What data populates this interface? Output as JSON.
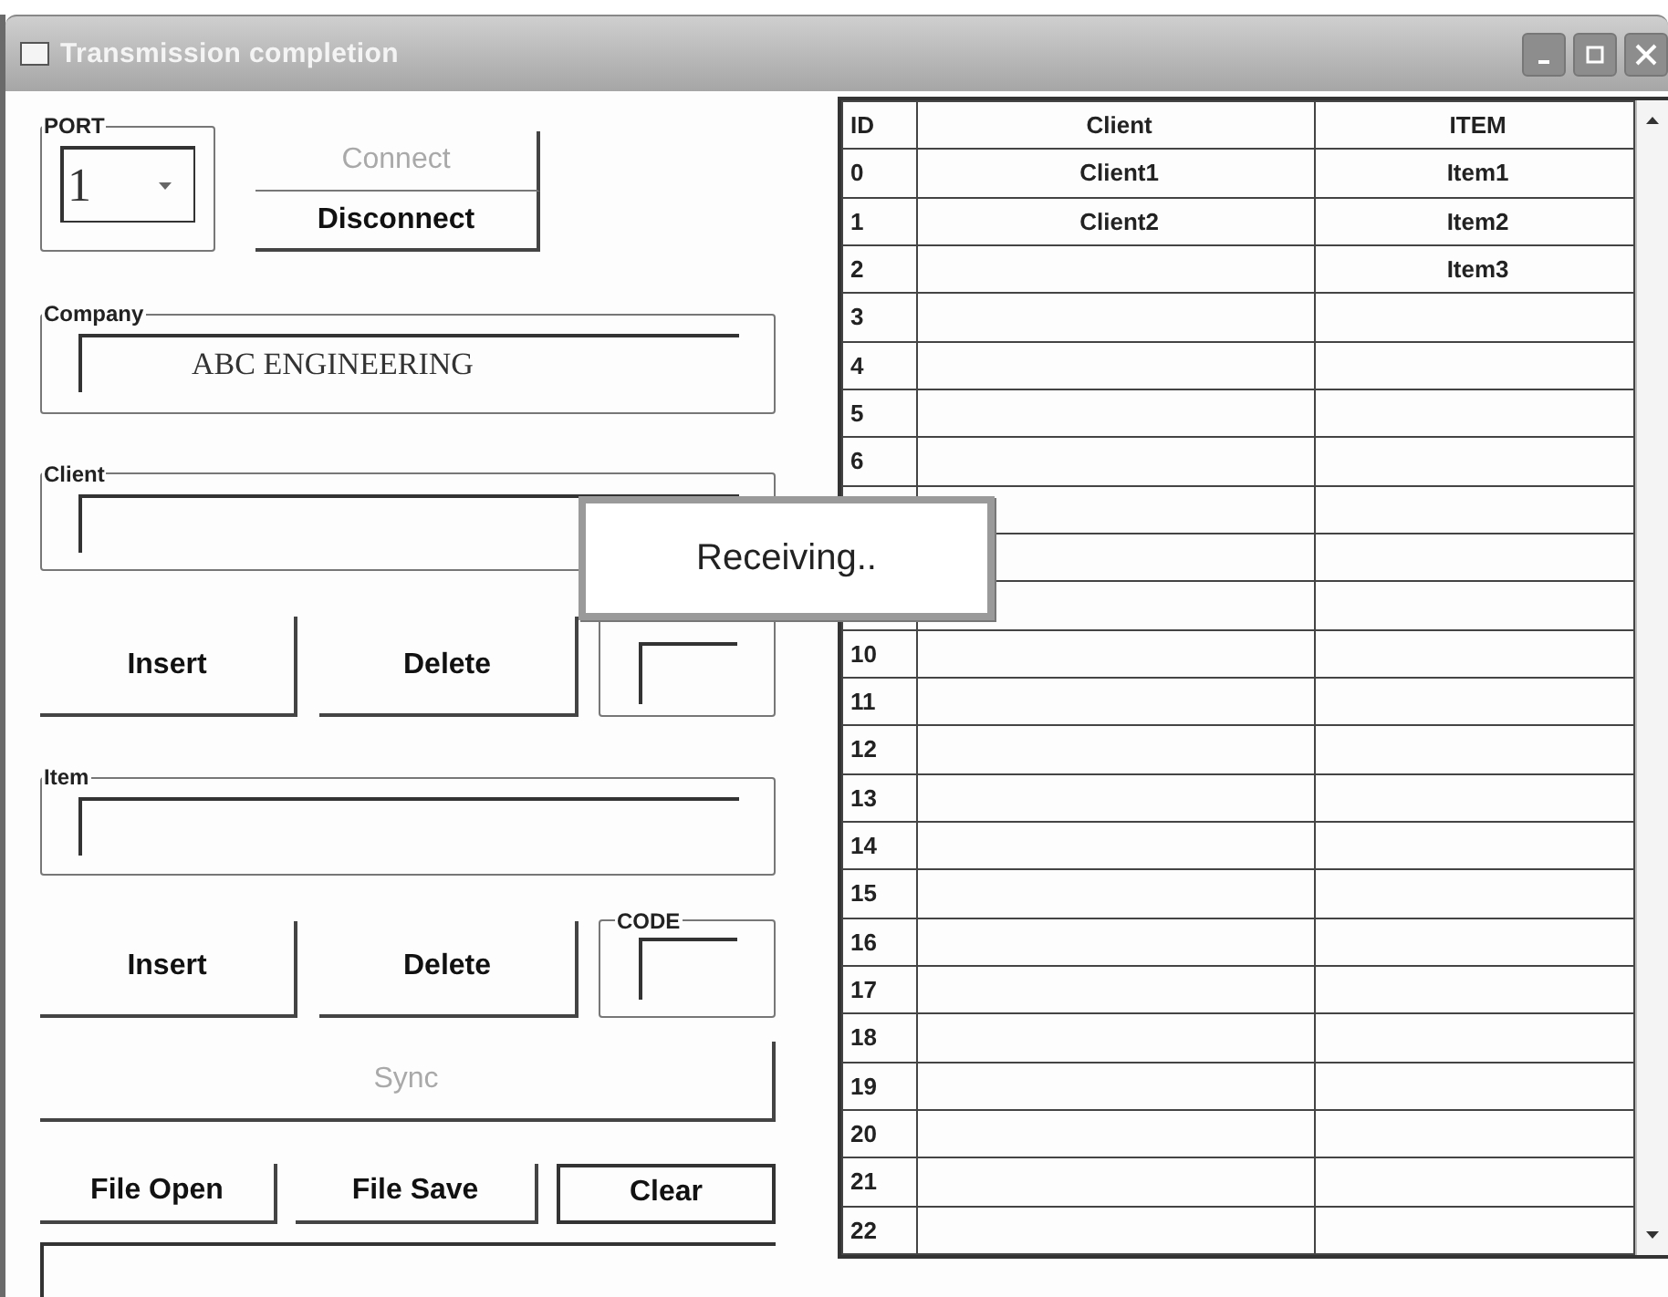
{
  "window": {
    "title": "Transmission completion"
  },
  "port": {
    "label": "PORT",
    "value": "1"
  },
  "connection_buttons": [
    {
      "label": "Connect",
      "disabled": true
    },
    {
      "label": "Disconnect",
      "disabled": false
    }
  ],
  "company": {
    "label": "Company",
    "value": "ABC ENGINEERING"
  },
  "client": {
    "label": "Client"
  },
  "client_actions": {
    "buttons": [
      {
        "label": "Insert"
      },
      {
        "label": "Delete"
      }
    ]
  },
  "item": {
    "label": "Item"
  },
  "item_actions": {
    "buttons": [
      {
        "label": "Insert"
      },
      {
        "label": "Delete"
      }
    ],
    "code_label": "CODE"
  },
  "sync_button": {
    "label": "Sync",
    "disabled": true
  },
  "file_buttons": [
    {
      "label": "File Open",
      "focused": false
    },
    {
      "label": "File Save",
      "focused": false
    },
    {
      "label": "Clear",
      "focused": true
    }
  ],
  "table": {
    "columns": [
      "ID",
      "Client",
      "ITEM"
    ],
    "rows": [
      {
        "id": "0",
        "client": "Client1",
        "item": "Item1"
      },
      {
        "id": "1",
        "client": "Client2",
        "item": "Item2"
      },
      {
        "id": "2",
        "item": "Item3"
      },
      {
        "id": "3"
      },
      {
        "id": "4"
      },
      {
        "id": "5"
      },
      {
        "id": "6"
      },
      {},
      {},
      {},
      {
        "id": "10"
      },
      {
        "id": "11"
      },
      {
        "id": "12"
      },
      {
        "id": "13"
      },
      {
        "id": "14"
      },
      {
        "id": "15"
      },
      {
        "id": "16"
      },
      {
        "id": "17"
      },
      {
        "id": "18"
      },
      {
        "id": "19"
      },
      {
        "id": "20"
      },
      {
        "id": "21"
      },
      {
        "id": "22"
      }
    ]
  },
  "popup": {
    "message": "Receiving.."
  }
}
